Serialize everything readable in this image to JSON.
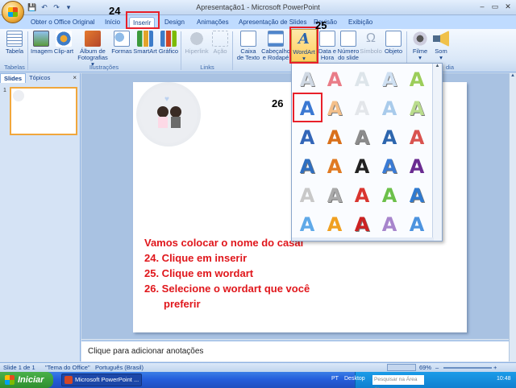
{
  "window": {
    "title": "Apresentação1 - Microsoft PowerPoint",
    "controls": {
      "minimize": "–",
      "maximize": "▭",
      "close": "✕"
    }
  },
  "qat": {
    "save": "💾",
    "undo": "↶",
    "redo": "↷",
    "more": "▾"
  },
  "tabs": [
    {
      "label": "Obter o Office Original"
    },
    {
      "label": "Início"
    },
    {
      "label": "Inserir"
    },
    {
      "label": "Design"
    },
    {
      "label": "Animações"
    },
    {
      "label": "Apresentação de Slides"
    },
    {
      "label": "Revisão"
    },
    {
      "label": "Exibição"
    }
  ],
  "ribbon": {
    "buttons": {
      "tabela": "Tabela",
      "imagem": "Imagem",
      "clipart": "Clip-art",
      "album_line1": "Álbum de",
      "album_line2": "Fotografias ▾",
      "formas": "Formas",
      "smartart": "SmartArt",
      "grafico": "Gráfico",
      "hiperlink": "Hiperlink",
      "acao": "Ação",
      "caixa_line1": "Caixa",
      "caixa_line2": "de Texto",
      "cabecalho_line1": "Cabeçalho",
      "cabecalho_line2": "e Rodapé",
      "wordart_line1": "WordArt",
      "wordart_line2": "▾",
      "data_line1": "Data e",
      "data_line2": "Hora",
      "numero_line1": "Número",
      "numero_line2": "do slide",
      "simbolo": "Símbolo",
      "objeto": "Objeto",
      "filme_line1": "Filme",
      "filme_line2": "▾",
      "som_line1": "Som",
      "som_line2": "▾"
    },
    "groups": {
      "tabelas": "Tabelas",
      "ilustracoes": "Ilustrações",
      "links": "Links",
      "midia_partial": "dia"
    }
  },
  "annotations": {
    "n24": "24",
    "n25": "25",
    "n26": "26"
  },
  "left_panel": {
    "tab_slides": "Slides",
    "tab_topicos": "Tópicos",
    "close": "×",
    "thumb_number": "1"
  },
  "slide": {
    "heart": "♥",
    "instructions": [
      "Vamos colocar o nome do casal",
      "24. Clique em inserir",
      "25. Clique em wordart",
      "26. Selecione o wordart que você",
      "preferir"
    ]
  },
  "notes": {
    "placeholder": "Clique para adicionar anotações"
  },
  "status": {
    "slide": "Slide 1 de 1",
    "theme": "\"Tema do Office\"",
    "language": "Português (Brasil)",
    "zoom": "69%",
    "minus": "–",
    "plus": "+"
  },
  "wordart": {
    "glyph": "A",
    "colors": [
      "#cfd8e3",
      "#e97c87",
      "#dde5ea",
      "#cfe0f2",
      "#9ccd5a",
      "#3a78d2",
      "#f4c08a",
      "#e3e6ea",
      "#a9cbeb",
      "#b9dc8c",
      "#3366b8",
      "#d9701a",
      "#8c8c8c",
      "#2d66ae",
      "#d9534f",
      "#2f6fc0",
      "#e07a22",
      "#222222",
      "#3a7bd5",
      "#6a2c91",
      "#c8c8c8",
      "#aaaaaa",
      "#d9352f",
      "#6cc04a",
      "#2f7ad0",
      "#5fa9e8",
      "#f0a020",
      "#cc2222",
      "#a785cc",
      "#4c93df"
    ]
  },
  "taskbar": {
    "start": "Iniciar",
    "item": "Microsoft PowerPoint ...",
    "lang": "PT",
    "desktop": "Desktop",
    "search": "Pesquisar na Área de",
    "clock": "10:48"
  },
  "icons": [
    "save-icon",
    "undo-icon",
    "redo-icon",
    "table-icon",
    "picture-icon",
    "clipart-icon",
    "album-icon",
    "shapes-icon",
    "smartart-icon",
    "chart-icon",
    "hyperlink-icon",
    "action-icon",
    "textbox-icon",
    "header-footer-icon",
    "wordart-icon",
    "datetime-icon",
    "slide-number-icon",
    "symbol-icon",
    "object-icon",
    "movie-icon",
    "sound-icon"
  ]
}
